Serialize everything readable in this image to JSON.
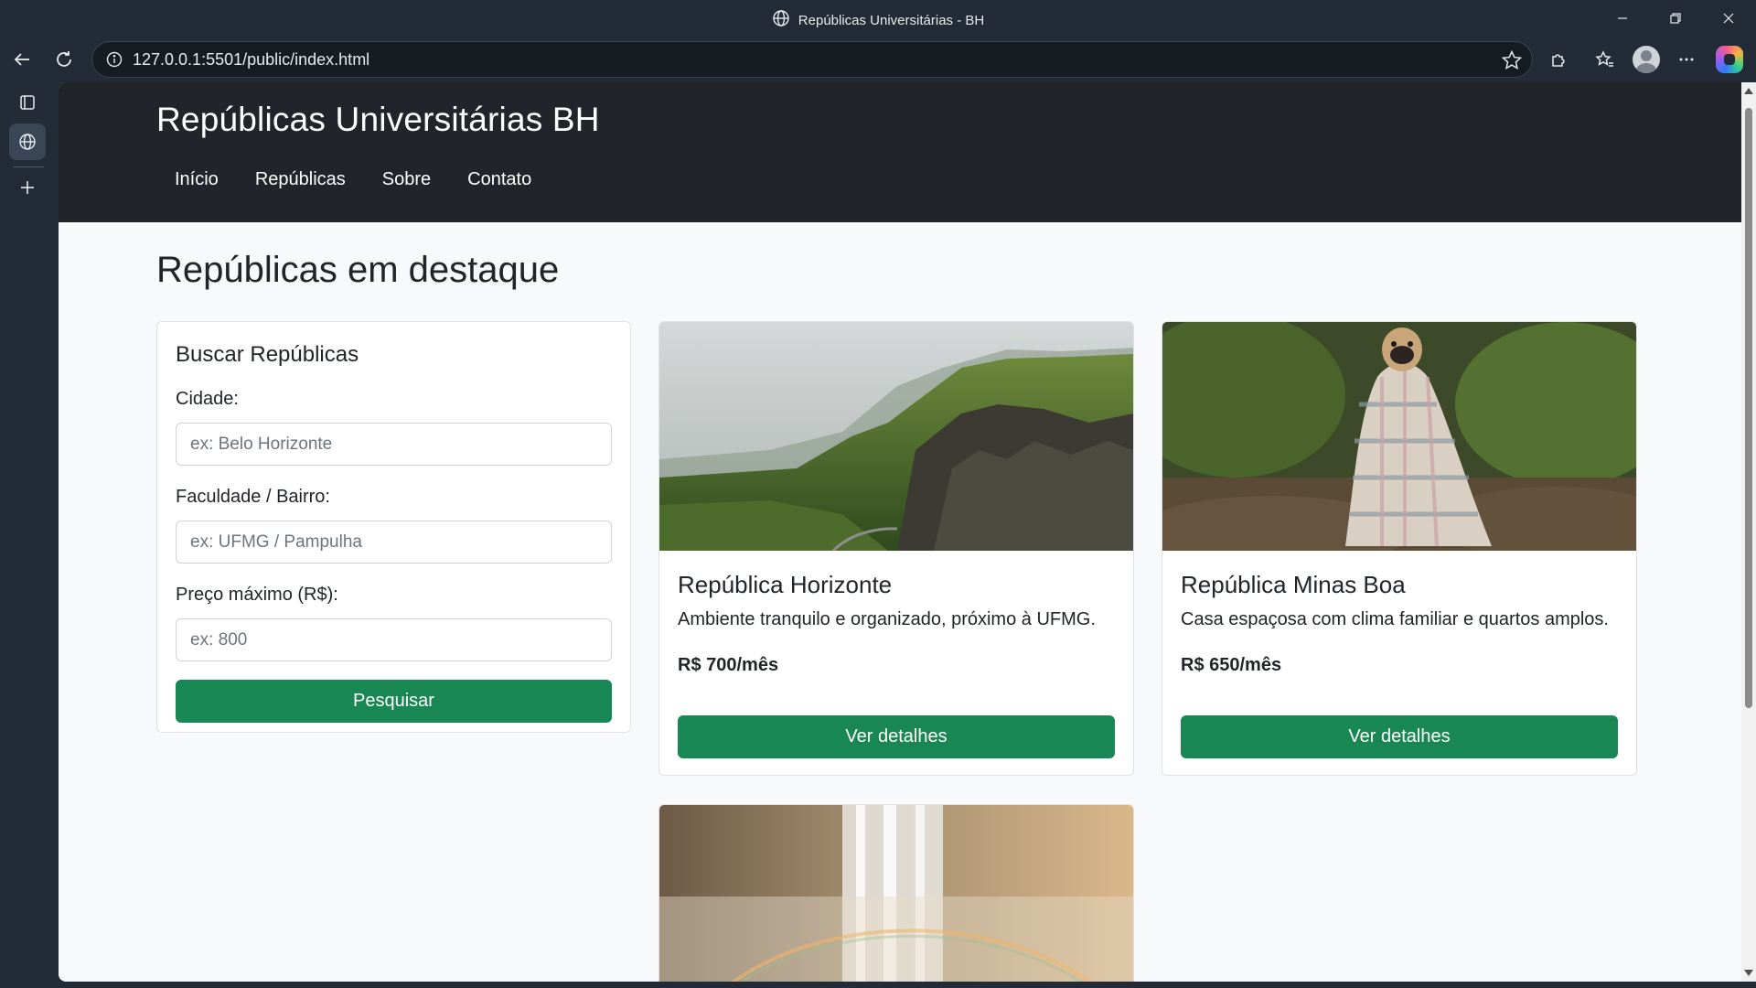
{
  "browser": {
    "tab_title": "Repúblicas Universitárias - BH",
    "url": "127.0.0.1:5501/public/index.html"
  },
  "site": {
    "title": "Repúblicas Universitárias BH",
    "nav": [
      "Início",
      "Repúblicas",
      "Sobre",
      "Contato"
    ]
  },
  "main": {
    "section_title": "Repúblicas em destaque",
    "search": {
      "title": "Buscar Repúblicas",
      "city_label": "Cidade:",
      "city_placeholder": "ex: Belo Horizonte",
      "faculty_label": "Faculdade / Bairro:",
      "faculty_placeholder": "ex: UFMG / Pampulha",
      "price_label": "Preço máximo (R$):",
      "price_placeholder": "ex: 800",
      "button": "Pesquisar"
    },
    "republicas": [
      {
        "name": "República Horizonte",
        "description": "Ambiente tranquilo e organizado, próximo à UFMG.",
        "price": "R$ 700/mês",
        "button": "Ver detalhes",
        "image": "mountain-landscape"
      },
      {
        "name": "República Minas Boa",
        "description": "Casa espaçosa com clima familiar e quartos amplos.",
        "price": "R$ 650/mês",
        "button": "Ver detalhes",
        "image": "pug-in-blanket"
      },
      {
        "image": "waterfall-rainbow"
      }
    ]
  },
  "colors": {
    "header_bg": "#212529",
    "primary_button": "#198754",
    "page_bg": "#f8f9fa"
  }
}
